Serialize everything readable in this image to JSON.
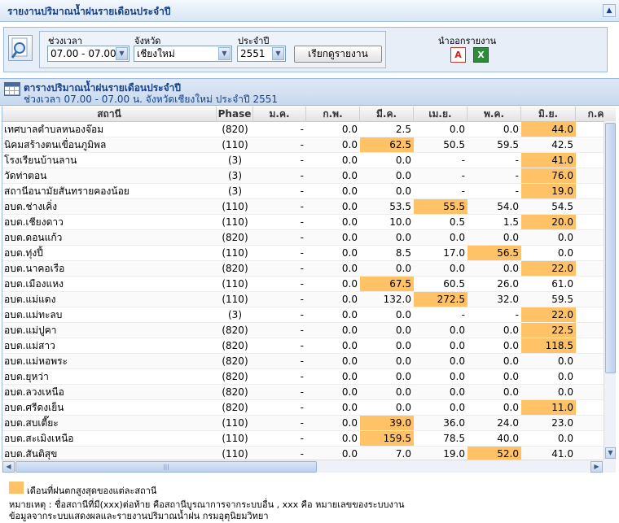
{
  "page": {
    "title": "รายงานปริมาณน้ำฝนรายเดือนประจำปี",
    "collapse_icon": "double-chevron-up-icon"
  },
  "filters": {
    "period_label": "ช่วงเวลา",
    "period_value": "07.00 - 07.00",
    "province_label": "จังหวัด",
    "province_value": "เชียงใหม่",
    "year_label": "ประจำปี",
    "year_value": "2551",
    "report_button": "เรียกดูรายงาน",
    "export_label": "นำออกรายงาน",
    "pdf_icon": "pdf-icon",
    "excel_icon": "excel-icon"
  },
  "grid": {
    "title": "ตารางปริมาณน้ำฝนรายเดือนประจำปี",
    "subtitle": "ช่วงเวลา 07.00 - 07.00 น. จังหวัดเชียงใหม่ ประจำปี 2551",
    "columns": [
      "สถานี",
      "Phase",
      "ม.ค.",
      "ก.พ.",
      "มี.ค.",
      "เม.ย.",
      "พ.ค.",
      "มิ.ย.",
      "ก.ค"
    ],
    "highlight_color": "#ffc266",
    "rows": [
      {
        "name": "เทศบาลตำบลหนองจ๊อม",
        "phase": "(820)",
        "values": [
          "-",
          "0.0",
          "2.5",
          "0.0",
          "0.0",
          "44.0",
          ""
        ],
        "highlight": [
          5
        ]
      },
      {
        "name": "นิคมสร้างตนเขื่อนภูมิพล",
        "phase": "(110)",
        "values": [
          "-",
          "0.0",
          "62.5",
          "50.5",
          "59.5",
          "42.5",
          ""
        ],
        "highlight": [
          2
        ]
      },
      {
        "name": "โรงเรียนบ้านลาน",
        "phase": "(3)",
        "values": [
          "-",
          "0.0",
          "0.0",
          "-",
          "-",
          "41.0",
          ""
        ],
        "highlight": [
          5
        ]
      },
      {
        "name": "วัดท่าตอน",
        "phase": "(3)",
        "values": [
          "-",
          "0.0",
          "0.0",
          "-",
          "-",
          "76.0",
          ""
        ],
        "highlight": [
          5
        ]
      },
      {
        "name": "สถานีอนามัยสันทรายคองน้อย",
        "phase": "(3)",
        "values": [
          "-",
          "0.0",
          "0.0",
          "-",
          "-",
          "19.0",
          ""
        ],
        "highlight": [
          5
        ]
      },
      {
        "name": "อบต.ช่างเคิ่ง",
        "phase": "(110)",
        "values": [
          "-",
          "0.0",
          "53.5",
          "55.5",
          "54.0",
          "54.5",
          ""
        ],
        "highlight": [
          3
        ]
      },
      {
        "name": "อบต.เชียงดาว",
        "phase": "(110)",
        "values": [
          "-",
          "0.0",
          "10.0",
          "0.5",
          "1.5",
          "20.0",
          ""
        ],
        "highlight": [
          5
        ]
      },
      {
        "name": "อบต.ดอนแก้ว",
        "phase": "(820)",
        "values": [
          "-",
          "0.0",
          "0.0",
          "0.0",
          "0.0",
          "0.0",
          ""
        ],
        "highlight": []
      },
      {
        "name": "อบต.ทุ่งปี้",
        "phase": "(110)",
        "values": [
          "-",
          "0.0",
          "8.5",
          "17.0",
          "56.5",
          "0.0",
          ""
        ],
        "highlight": [
          4
        ]
      },
      {
        "name": "อบต.นาคอเรือ",
        "phase": "(820)",
        "values": [
          "-",
          "0.0",
          "0.0",
          "0.0",
          "0.0",
          "22.0",
          ""
        ],
        "highlight": [
          5
        ]
      },
      {
        "name": "อบต.เมืองแหง",
        "phase": "(110)",
        "values": [
          "-",
          "0.0",
          "67.5",
          "60.5",
          "26.0",
          "61.0",
          ""
        ],
        "highlight": [
          2
        ]
      },
      {
        "name": "อบต.แม่แดง",
        "phase": "(110)",
        "values": [
          "-",
          "0.0",
          "132.0",
          "272.5",
          "32.0",
          "59.5",
          ""
        ],
        "highlight": [
          3
        ]
      },
      {
        "name": "อบต.แม่ทะลบ",
        "phase": "(3)",
        "values": [
          "-",
          "0.0",
          "0.0",
          "-",
          "-",
          "22.0",
          ""
        ],
        "highlight": [
          5
        ]
      },
      {
        "name": "อบต.แม่ปูคา",
        "phase": "(820)",
        "values": [
          "-",
          "0.0",
          "0.0",
          "0.0",
          "0.0",
          "22.5",
          ""
        ],
        "highlight": [
          5
        ]
      },
      {
        "name": "อบต.แม่สาว",
        "phase": "(820)",
        "values": [
          "-",
          "0.0",
          "0.0",
          "0.0",
          "0.0",
          "118.5",
          ""
        ],
        "highlight": [
          5
        ]
      },
      {
        "name": "อบต.แม่หอพระ",
        "phase": "(820)",
        "values": [
          "-",
          "0.0",
          "0.0",
          "0.0",
          "0.0",
          "0.0",
          ""
        ],
        "highlight": []
      },
      {
        "name": "อบต.ยุหว่า",
        "phase": "(820)",
        "values": [
          "-",
          "0.0",
          "0.0",
          "0.0",
          "0.0",
          "0.0",
          ""
        ],
        "highlight": []
      },
      {
        "name": "อบต.ลวงเหนือ",
        "phase": "(820)",
        "values": [
          "-",
          "0.0",
          "0.0",
          "0.0",
          "0.0",
          "0.0",
          ""
        ],
        "highlight": []
      },
      {
        "name": "อบต.ศรีดงเย็น",
        "phase": "(820)",
        "values": [
          "-",
          "0.0",
          "0.0",
          "0.0",
          "0.0",
          "11.0",
          ""
        ],
        "highlight": [
          5
        ]
      },
      {
        "name": "อบต.สบเตี๊ยะ",
        "phase": "(110)",
        "values": [
          "-",
          "0.0",
          "39.0",
          "36.0",
          "24.0",
          "23.0",
          ""
        ],
        "highlight": [
          2
        ]
      },
      {
        "name": "อบต.สะเมิงเหนือ",
        "phase": "(110)",
        "values": [
          "-",
          "0.0",
          "159.5",
          "78.5",
          "40.0",
          "0.0",
          ""
        ],
        "highlight": [
          2
        ]
      },
      {
        "name": "อบต.สันติสุข",
        "phase": "(110)",
        "values": [
          "-",
          "0.0",
          "7.0",
          "19.0",
          "52.0",
          "41.0",
          ""
        ],
        "highlight": [
          4
        ]
      }
    ]
  },
  "footer": {
    "legend_text": "เดือนที่ฝนตกสูงสุดของแต่ละสถานี",
    "note_line1": "หมายเหตุ : ชื่อสถานีที่มี(xxx)ต่อท้าย คือสถานีบูรณาการจากระบบอื่น , xxx คือ หมายเลขของระบบงาน",
    "note_line2": "ข้อมูลจากระบบแสดงผลและรายงานปริมาณน้ำฝน กรมอุตุนิยมวิทยา"
  }
}
